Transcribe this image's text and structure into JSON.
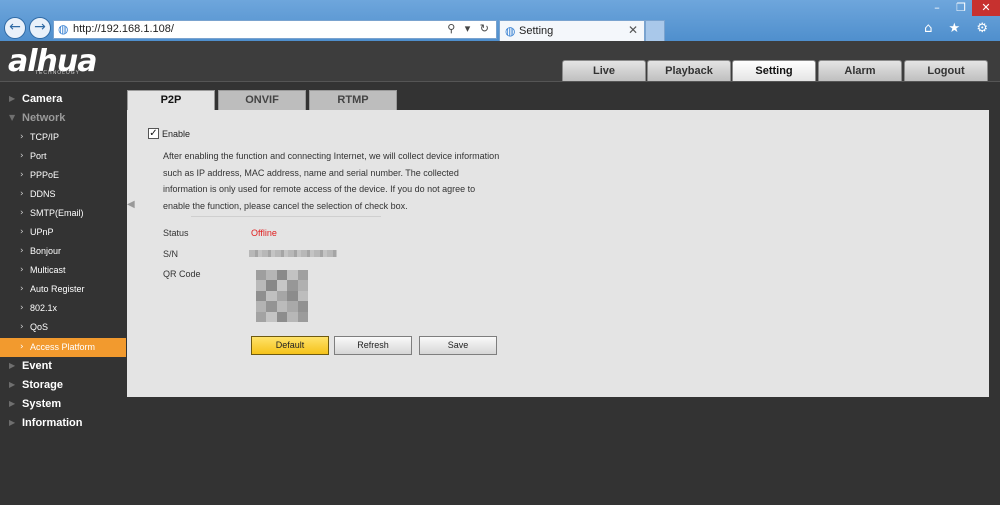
{
  "browser": {
    "url": "http://192.168.1.108/",
    "tab_title": "Setting",
    "back_icon": "back-arrow-icon",
    "forward_icon": "forward-arrow-icon",
    "address_actions": "⚲ ▾ ↻",
    "window_controls": {
      "minimize": "–",
      "maximize": "❐",
      "close": "✕"
    },
    "toolbar_icons": "⌂ ★ ⚙"
  },
  "brand": {
    "logo": "alhua",
    "subtitle": "TECHNOLOGY"
  },
  "top_nav": [
    {
      "label": "Live",
      "active": false
    },
    {
      "label": "Playback",
      "active": false
    },
    {
      "label": "Setting",
      "active": true
    },
    {
      "label": "Alarm",
      "active": false
    },
    {
      "label": "Logout",
      "active": false
    }
  ],
  "sidebar": {
    "items": [
      {
        "label": "Camera",
        "type": "section"
      },
      {
        "label": "Network",
        "type": "section-open"
      },
      {
        "label": "TCP/IP",
        "type": "child"
      },
      {
        "label": "Port",
        "type": "child"
      },
      {
        "label": "PPPoE",
        "type": "child"
      },
      {
        "label": "DDNS",
        "type": "child"
      },
      {
        "label": "SMTP(Email)",
        "type": "child"
      },
      {
        "label": "UPnP",
        "type": "child"
      },
      {
        "label": "Bonjour",
        "type": "child"
      },
      {
        "label": "Multicast",
        "type": "child"
      },
      {
        "label": "Auto Register",
        "type": "child"
      },
      {
        "label": "802.1x",
        "type": "child"
      },
      {
        "label": "QoS",
        "type": "child"
      },
      {
        "label": "Access Platform",
        "type": "child-active"
      },
      {
        "label": "Event",
        "type": "section"
      },
      {
        "label": "Storage",
        "type": "section"
      },
      {
        "label": "System",
        "type": "section"
      },
      {
        "label": "Information",
        "type": "section"
      }
    ]
  },
  "content": {
    "tabs": [
      {
        "label": "P2P",
        "active": true
      },
      {
        "label": "ONVIF",
        "active": false
      },
      {
        "label": "RTMP",
        "active": false
      }
    ],
    "enable": {
      "label": "Enable",
      "checked": true
    },
    "notice_lines": [
      "After enabling the function and connecting Internet, we will collect device information",
      "such as IP address, MAC address, name and serial number. The collected",
      "information is only used for remote access of the device. If you do not agree to",
      "enable the function, please cancel the selection of check box."
    ],
    "status_label": "Status",
    "status_value": "Offline",
    "sn_label": "S/N",
    "qr_label": "QR Code",
    "buttons": {
      "default": "Default",
      "refresh": "Refresh",
      "save": "Save"
    }
  },
  "colors": {
    "accent_active": "#f29a2e",
    "status_offline": "#e02020",
    "default_button": "#f5c21a",
    "background": "#333333",
    "panel": "#e4e4e4"
  }
}
